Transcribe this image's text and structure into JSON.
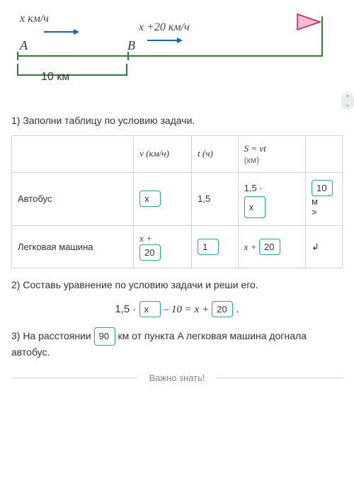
{
  "diagram": {
    "speedA": "x км/ч",
    "speedB": "x +20 км/ч",
    "pointA": "A",
    "pointB": "B",
    "distance": "10  км"
  },
  "task1": "1) Заполни таблицу по условию задачи.",
  "table": {
    "headers": {
      "v": "v (км/ч)",
      "t": "t (ч)",
      "s_formula": "S = vt",
      "s_unit": "(км)"
    },
    "bus": {
      "name": "Автобус",
      "v": "x",
      "t": "1,5",
      "s_prefix": "1,5 ·",
      "s_val": "x",
      "extra": "10",
      "extra_unit": "м",
      "extra_sign": ">"
    },
    "car": {
      "name": "Легковая машина",
      "v_prefix": "x +",
      "v_val": "20",
      "t": "1",
      "s_prefix": "x +",
      "s_val": "20",
      "arrow": "↲"
    }
  },
  "task2": "2) Составь уравнение по условию задачи и реши его.",
  "equation": {
    "p1": "1,5 ·",
    "b1": "x",
    "p2": "  – 10 = x +",
    "b2": "20",
    "end": "."
  },
  "task3": {
    "p1": "3) На расстоянии",
    "val": "90",
    "p2": "км от пункта A легковая машина догнала автобус."
  },
  "footer": "Важно знать!"
}
